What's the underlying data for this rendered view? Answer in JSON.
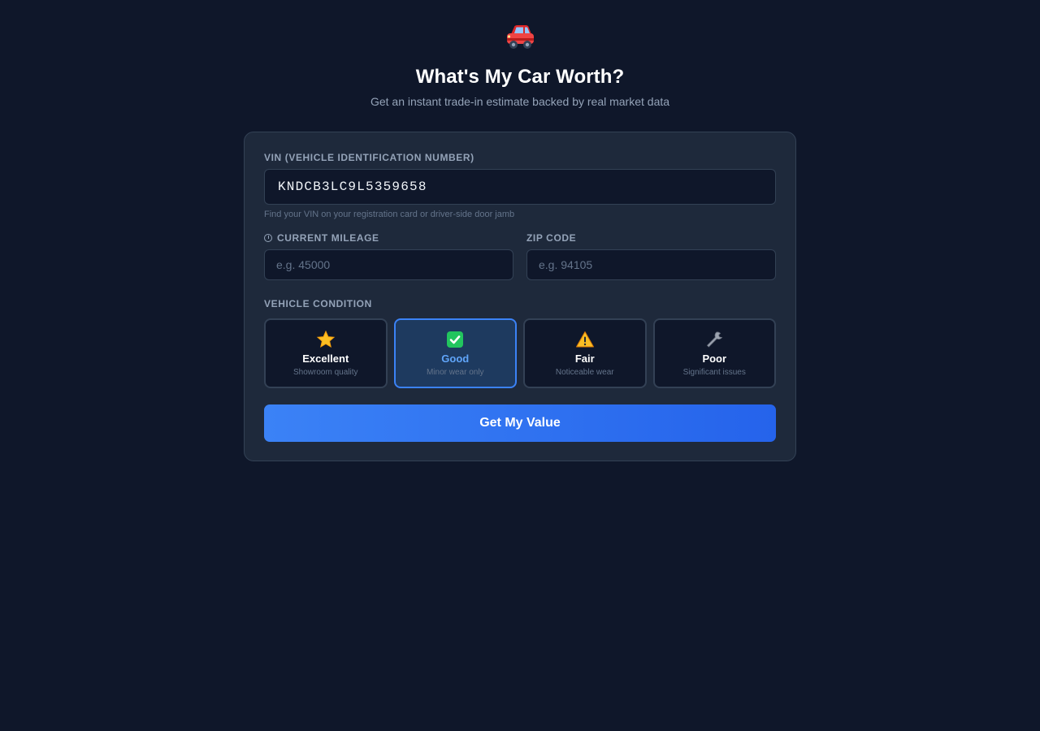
{
  "header": {
    "icon": "car-icon",
    "title": "What's My Car Worth?",
    "subtitle": "Get an instant trade-in estimate backed by real market data"
  },
  "form": {
    "vin": {
      "label": "VIN (Vehicle Identification Number)",
      "value": "KNDCB3LC9L5359658",
      "hint": "Find your VIN on your registration card or driver-side door jamb"
    },
    "mileage": {
      "icon": "gauge-icon",
      "label": "Current Mileage",
      "value": "",
      "placeholder": "e.g. 45000"
    },
    "zip": {
      "label": "ZIP Code",
      "value": "",
      "placeholder": "e.g. 94105"
    },
    "condition": {
      "label": "Vehicle Condition",
      "selected": "Good",
      "options": [
        {
          "name": "Excellent",
          "desc": "Showroom quality",
          "icon": "star-icon"
        },
        {
          "name": "Good",
          "desc": "Minor wear only",
          "icon": "check-icon"
        },
        {
          "name": "Fair",
          "desc": "Noticeable wear",
          "icon": "warning-icon"
        },
        {
          "name": "Poor",
          "desc": "Significant issues",
          "icon": "wrench-icon"
        }
      ]
    },
    "submit_label": "Get My Value"
  },
  "colors": {
    "background": "#0f172a",
    "card": "#1e293b",
    "accent": "#3b82f6",
    "selected_text": "#60a5fa"
  }
}
